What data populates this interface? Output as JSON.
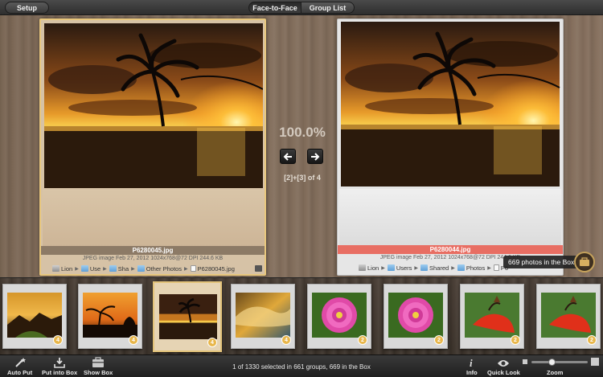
{
  "toolbar": {
    "setup_label": "Setup",
    "tabs": [
      {
        "label": "Face-to-Face",
        "active": true
      },
      {
        "label": "Group List",
        "active": false
      }
    ]
  },
  "left_photo": {
    "filename": "P6280045.jpg",
    "meta": "JPEG image   Feb 27, 2012   1024x768@72 DPI   244.6 KB",
    "path": [
      "Lion",
      "Use",
      "Sha",
      "Other Photos",
      "P6280045.jpg"
    ]
  },
  "right_photo": {
    "filename": "P6280044.jpg",
    "meta": "JPEG image   Feb 27, 2012   1024x768@72 DPI   244.6 KB",
    "path": [
      "Lion",
      "Users",
      "Shared",
      "Photos",
      "P6"
    ]
  },
  "center": {
    "similarity": "100.0%",
    "pair_count": "[2]+[3] of 4"
  },
  "box": {
    "tooltip": "669 photos in the Box"
  },
  "filmstrip": [
    {
      "badge": "4",
      "scene": "mountain-sunset",
      "selected": false
    },
    {
      "badge": "4",
      "scene": "tree-sunset",
      "selected": false
    },
    {
      "badge": "4",
      "scene": "palm-sunset",
      "selected": true
    },
    {
      "badge": "4",
      "scene": "wave",
      "selected": false
    },
    {
      "badge": "2",
      "scene": "pink-flower",
      "selected": false
    },
    {
      "badge": "2",
      "scene": "pink-flower",
      "selected": false
    },
    {
      "badge": "2",
      "scene": "red-flower",
      "selected": false
    },
    {
      "badge": "2",
      "scene": "red-flower",
      "selected": false
    }
  ],
  "bottombar": {
    "auto_put": "Auto Put",
    "put_into_box": "Put into Box",
    "show_box": "Show Box",
    "status": "1 of 1330 selected in 661 groups, 669 in the Box",
    "info": "Info",
    "quick_look": "Quick Look",
    "zoom": "Zoom",
    "zoom_level": 0.35
  },
  "colors": {
    "selection_border": "#e3c37a",
    "badge": "#e8b64a",
    "highlight_bar": "#e86e63"
  }
}
